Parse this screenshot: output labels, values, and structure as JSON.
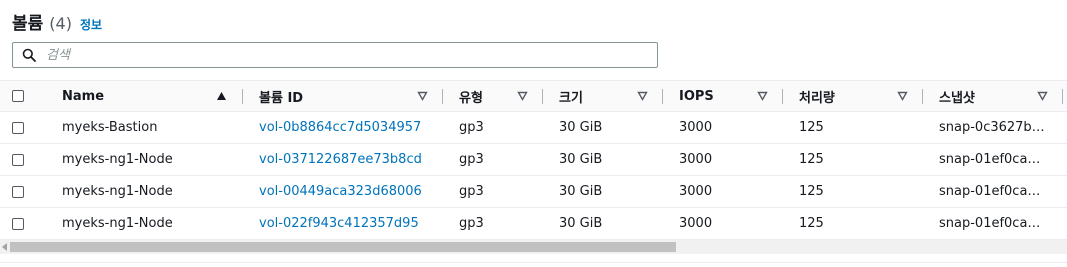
{
  "header": {
    "title": "볼륨",
    "count": "(4)",
    "info": "정보"
  },
  "search": {
    "placeholder": "검색",
    "value": ""
  },
  "table": {
    "columns": [
      "Name",
      "볼륨 ID",
      "유형",
      "크기",
      "IOPS",
      "처리량",
      "스냅샷"
    ],
    "rows": [
      [
        "myeks-Bastion",
        "vol-0b8864cc7d5034957",
        "gp3",
        "30 GiB",
        "3000",
        "125",
        "snap-0c3627b…"
      ],
      [
        "myeks-ng1-Node",
        "vol-037122687ee73b8cd",
        "gp3",
        "30 GiB",
        "3000",
        "125",
        "snap-01ef0ca…"
      ],
      [
        "myeks-ng1-Node",
        "vol-00449aca323d68006",
        "gp3",
        "30 GiB",
        "3000",
        "125",
        "snap-01ef0ca…"
      ],
      [
        "myeks-ng1-Node",
        "vol-022f943c412357d95",
        "gp3",
        "30 GiB",
        "3000",
        "125",
        "snap-01ef0ca…"
      ]
    ]
  },
  "icons": {
    "search": "search-icon",
    "sort_asc": "sort-ascending-icon",
    "sort": "sort-descending-icon"
  },
  "colors": {
    "link": "#0073bb",
    "border": "#879596"
  }
}
